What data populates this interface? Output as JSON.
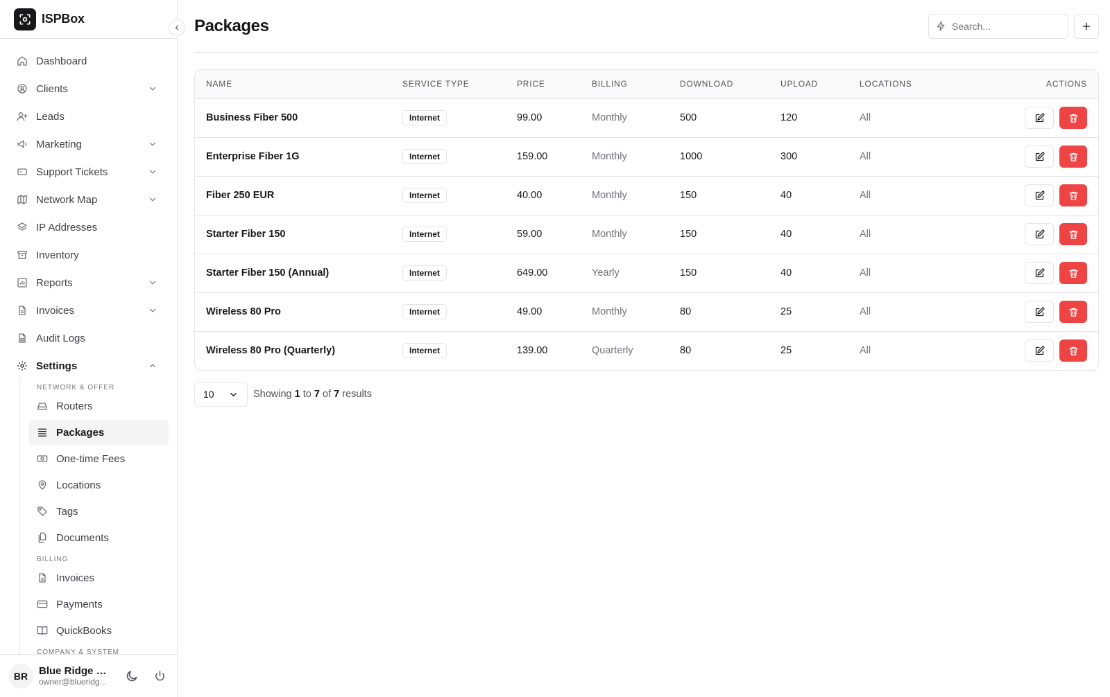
{
  "brand": {
    "name": "ISPBox"
  },
  "nav": {
    "items": [
      {
        "label": "Dashboard",
        "icon": "home-icon",
        "has_chevron": false
      },
      {
        "label": "Clients",
        "icon": "user-circle-icon",
        "has_chevron": true
      },
      {
        "label": "Leads",
        "icon": "user-plus-icon",
        "has_chevron": false
      },
      {
        "label": "Marketing",
        "icon": "megaphone-icon",
        "has_chevron": true
      },
      {
        "label": "Support Tickets",
        "icon": "ticket-icon",
        "has_chevron": true
      },
      {
        "label": "Network Map",
        "icon": "map-icon",
        "has_chevron": true
      },
      {
        "label": "IP Addresses",
        "icon": "layers-icon",
        "has_chevron": false
      },
      {
        "label": "Inventory",
        "icon": "archive-icon",
        "has_chevron": false
      },
      {
        "label": "Reports",
        "icon": "chart-icon",
        "has_chevron": true
      },
      {
        "label": "Invoices",
        "icon": "file-icon",
        "has_chevron": true
      },
      {
        "label": "Audit Logs",
        "icon": "file-lock-icon",
        "has_chevron": false
      }
    ],
    "settings": {
      "label": "Settings",
      "groups": [
        {
          "heading": "NETWORK & OFFER",
          "items": [
            {
              "label": "Routers",
              "icon": "router-icon"
            },
            {
              "label": "Packages",
              "icon": "list-icon",
              "active": true
            },
            {
              "label": "One-time Fees",
              "icon": "banknote-icon"
            },
            {
              "label": "Locations",
              "icon": "map-pin-icon"
            },
            {
              "label": "Tags",
              "icon": "tag-icon"
            },
            {
              "label": "Documents",
              "icon": "files-icon"
            }
          ]
        },
        {
          "heading": "BILLING",
          "items": [
            {
              "label": "Invoices",
              "icon": "file-icon"
            },
            {
              "label": "Payments",
              "icon": "credit-card-icon"
            },
            {
              "label": "QuickBooks",
              "icon": "book-icon"
            }
          ]
        },
        {
          "heading": "COMPANY & SYSTEM",
          "items": []
        }
      ]
    }
  },
  "user": {
    "initials": "BR",
    "name": "Blue Ridge O...",
    "email": "owner@blueridg..."
  },
  "page": {
    "title": "Packages"
  },
  "search": {
    "placeholder": "Search..."
  },
  "table": {
    "columns": [
      "NAME",
      "SERVICE TYPE",
      "PRICE",
      "BILLING",
      "DOWNLOAD",
      "UPLOAD",
      "LOCATIONS",
      "ACTIONS"
    ],
    "rows": [
      {
        "name": "Business Fiber 500",
        "service_type": "Internet",
        "price": "99.00",
        "billing": "Monthly",
        "download": "500",
        "upload": "120",
        "locations": "All"
      },
      {
        "name": "Enterprise Fiber 1G",
        "service_type": "Internet",
        "price": "159.00",
        "billing": "Monthly",
        "download": "1000",
        "upload": "300",
        "locations": "All"
      },
      {
        "name": "Fiber 250 EUR",
        "service_type": "Internet",
        "price": "40.00",
        "billing": "Monthly",
        "download": "150",
        "upload": "40",
        "locations": "All"
      },
      {
        "name": "Starter Fiber 150",
        "service_type": "Internet",
        "price": "59.00",
        "billing": "Monthly",
        "download": "150",
        "upload": "40",
        "locations": "All"
      },
      {
        "name": "Starter Fiber 150 (Annual)",
        "service_type": "Internet",
        "price": "649.00",
        "billing": "Yearly",
        "download": "150",
        "upload": "40",
        "locations": "All"
      },
      {
        "name": "Wireless 80 Pro",
        "service_type": "Internet",
        "price": "49.00",
        "billing": "Monthly",
        "download": "80",
        "upload": "25",
        "locations": "All"
      },
      {
        "name": "Wireless 80 Pro (Quarterly)",
        "service_type": "Internet",
        "price": "139.00",
        "billing": "Quarterly",
        "download": "80",
        "upload": "25",
        "locations": "All"
      }
    ]
  },
  "pagination": {
    "per_page": "10",
    "showing_prefix": "Showing",
    "from": "1",
    "to_word": "to",
    "to": "7",
    "of_word": "of",
    "total": "7",
    "suffix": "results"
  },
  "colors": {
    "danger": "#ef4444",
    "border": "#e4e4e7",
    "brand": "#18181b"
  }
}
